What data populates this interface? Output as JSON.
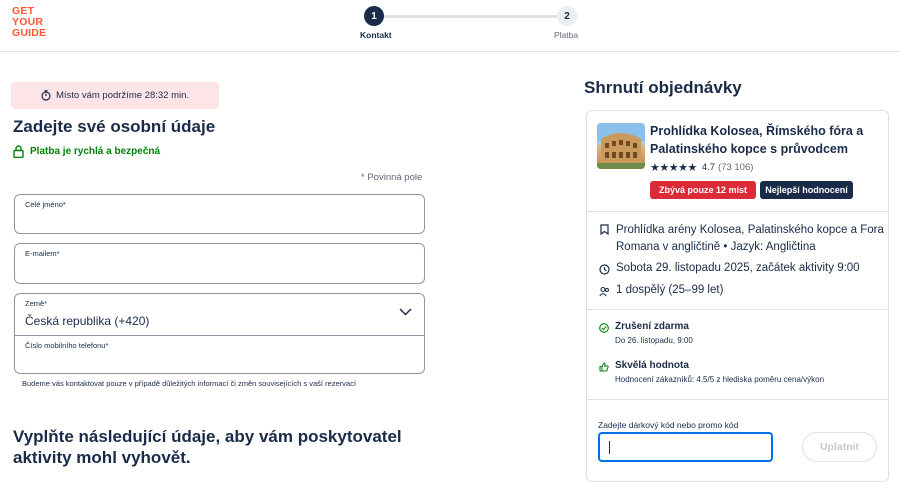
{
  "header": {
    "logo_lines": [
      "GET",
      "YOUR",
      "GUIDE"
    ],
    "brand_color": "#ff5533",
    "steps": [
      {
        "number": "1",
        "label": "Kontakt"
      },
      {
        "number": "2",
        "label": "Platba"
      }
    ]
  },
  "form": {
    "timer_text": "Místo vám podržíme 28:32 min.",
    "title": "Zadejte své osobní údaje",
    "secure_text": "Platba je rychlá a bezpečná",
    "required_note": "* Povinná pole",
    "name_label": "Celé jméno*",
    "name_value": "",
    "email_label": "E-mailem*",
    "email_value": "",
    "country_label": "Země*",
    "country_value": "Česká republika (+420)",
    "phone_label": "Číslo mobilního telefonu*",
    "phone_value": "",
    "phone_note": "Budeme vás kontaktovat pouze v případě důležitých informací či změn souvisejících s vaší rezervací",
    "section2_title": "Vyplňte následující údaje, aby vám poskytovatel aktivity mohl vyhovět."
  },
  "summary": {
    "title": "Shrnutí objednávky",
    "product_title": "Prohlídka Kolosea, Římského fóra a Palatinského kopce s průvodcem",
    "stars": "★★★★★",
    "rating": "4.7",
    "review_count": "(73 106)",
    "badge_red": "Zbývá pouze 12 míst",
    "badge_dark": "Nejlepší hodnocení",
    "option_text": "Prohlídka arény Kolosea, Palatinského kopce a Fora Romana v angličtině • Jazyk: Angličtina",
    "date_text": "Sobota 29. listopadu 2025, začátek aktivity 9:00",
    "participants_text": "1 dospělý (25–99 let)",
    "cancel_title": "Zrušení zdarma",
    "cancel_sub": "Do 26. listopadu, 9:00",
    "value_title": "Skvělá hodnota",
    "value_sub": "Hodnocení zákazníků: 4.5/5 z hlediska poměru cena/výkon",
    "promo_label": "Zadejte dárkový kód nebo promo kód",
    "promo_value": "",
    "promo_button": "Uplatnit"
  },
  "colors": {
    "navy": "#1a2b49",
    "green": "#008009",
    "badge_red": "#dc2b36",
    "timer_bg": "#fde5e7",
    "focus_blue": "#0071eb"
  },
  "icons": [
    "stopwatch-icon",
    "lock-icon",
    "chevron-down-icon",
    "ticket-icon",
    "clock-icon",
    "people-icon",
    "check-circle-icon",
    "thumbs-up-icon"
  ]
}
